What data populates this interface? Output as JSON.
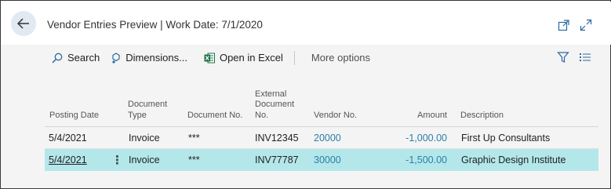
{
  "header": {
    "title": "Vendor Entries Preview | Work Date: 7/1/2020"
  },
  "toolbar": {
    "search_label": "Search",
    "dimensions_label": "Dimensions...",
    "excel_label": "Open in Excel",
    "more_label": "More options"
  },
  "table": {
    "columns": {
      "posting_date": "Posting Date",
      "document_type": "Document Type",
      "document_type_l1": "Document",
      "document_type_l2": "Type",
      "document_no": "Document No.",
      "ext_doc_l1": "External",
      "ext_doc_l2": "Document",
      "ext_doc_l3": "No.",
      "vendor_no": "Vendor No.",
      "amount": "Amount",
      "description": "Description"
    },
    "rows": [
      {
        "posting_date": "5/4/2021",
        "document_type": "Invoice",
        "document_no": "***",
        "external_document_no": "INV12345",
        "vendor_no": "20000",
        "amount": "-1,000.00",
        "description": "First Up Consultants",
        "selected": false
      },
      {
        "posting_date": "5/4/2021",
        "document_type": "Invoice",
        "document_no": "***",
        "external_document_no": "INV77787",
        "vendor_no": "30000",
        "amount": "-1,500.00",
        "description": "Graphic Design Institute",
        "selected": true
      }
    ],
    "row_menu_glyph": "⋮"
  },
  "colors": {
    "accent": "#2b7fa8",
    "selected_row": "#b4e7ea",
    "back_button_bg": "#e1e9f2",
    "excel_green": "#1e7145"
  }
}
